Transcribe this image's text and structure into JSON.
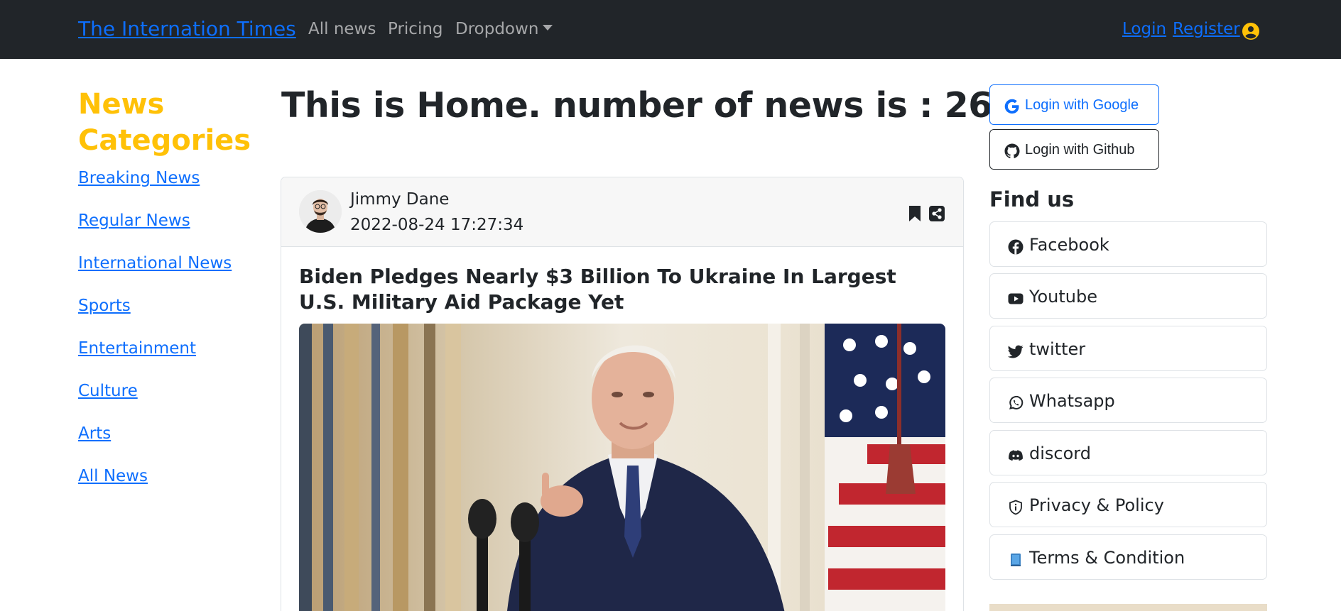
{
  "navbar": {
    "brand": "The Internation Times",
    "links": [
      "All news",
      "Pricing"
    ],
    "dropdown_label": "Dropdown",
    "login": "Login",
    "register": "Register",
    "user_icon": "user-circle-icon"
  },
  "categories": {
    "title": "News Categories",
    "items": [
      "Breaking News",
      "Regular News",
      "International News",
      "Sports",
      "Entertainment",
      "Culture",
      "Arts",
      "All News"
    ]
  },
  "main": {
    "heading": "This is Home. number of news is : 26",
    "card": {
      "author_name": "Jimmy Dane",
      "published": "2022-08-24 17:27:34",
      "title": "Biden Pledges Nearly $3 Billion To Ukraine In Largest U.S. Military Aid Package Yet",
      "icons": [
        "bookmark-icon",
        "share-icon"
      ]
    }
  },
  "right": {
    "login_google": "Login with Google",
    "login_github": "Login with Github",
    "find_us_title": "Find us",
    "social": [
      {
        "label": "Facebook",
        "icon": "facebook-icon"
      },
      {
        "label": "Youtube",
        "icon": "youtube-icon"
      },
      {
        "label": "twitter",
        "icon": "twitter-icon"
      },
      {
        "label": "Whatsapp",
        "icon": "whatsapp-icon"
      },
      {
        "label": "discord",
        "icon": "discord-icon"
      },
      {
        "label": "Privacy & Policy",
        "icon": "shield-icon"
      },
      {
        "label": "Terms & Condition",
        "icon": "book-icon"
      }
    ]
  },
  "colors": {
    "navbar_bg": "#212529",
    "link_blue": "#0d6efd",
    "category_yellow": "#ffc107"
  }
}
